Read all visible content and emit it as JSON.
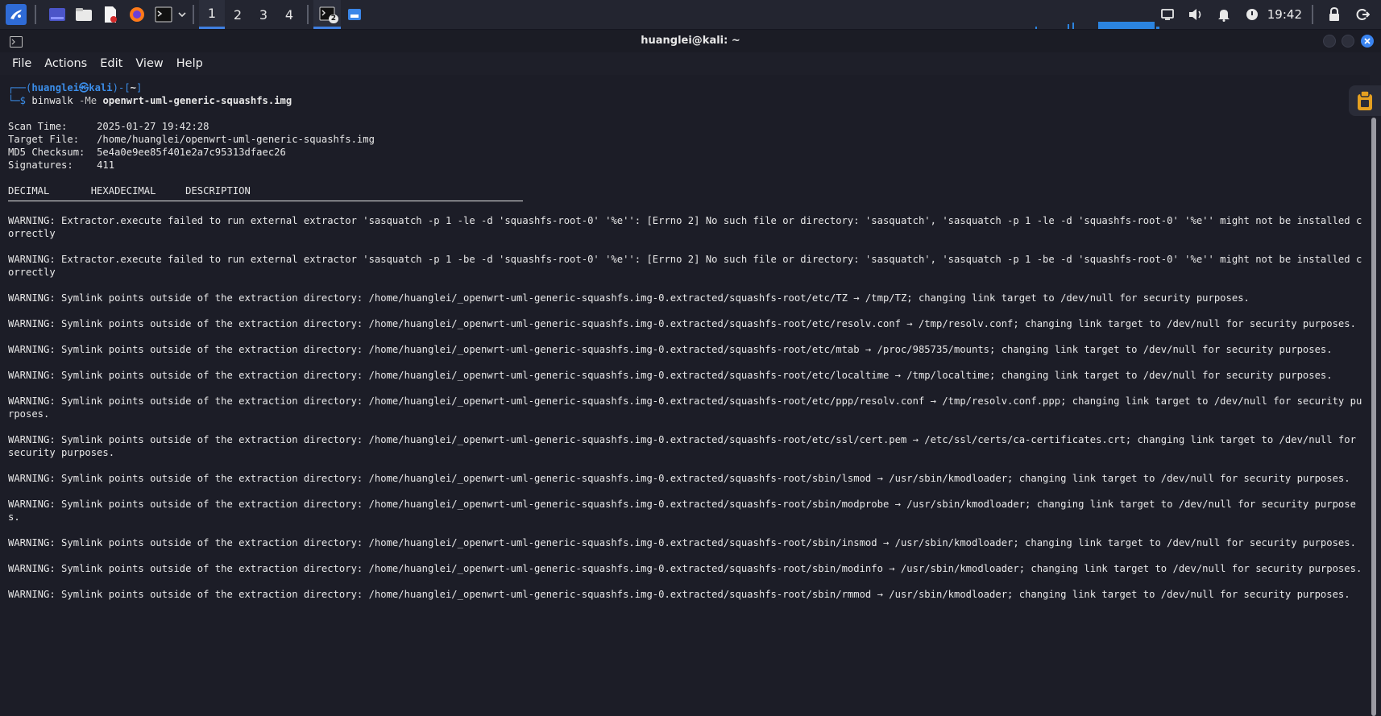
{
  "panel": {
    "workspaces": [
      "1",
      "2",
      "3",
      "4"
    ],
    "active_workspace": 0,
    "terminal_badge": "2",
    "clock": "19:42"
  },
  "window": {
    "title": "huanglei@kali: ~",
    "menu": [
      "File",
      "Actions",
      "Edit",
      "View",
      "Help"
    ]
  },
  "terminal": {
    "prompt_open": "┌──(",
    "prompt_user": "huanglei㉿kali",
    "prompt_mid": ")-[",
    "prompt_dir": "~",
    "prompt_close": "]",
    "prompt_dollar": "└─$",
    "cmd_name": "binwalk",
    "cmd_flags": "-Me",
    "cmd_arg": "openwrt-uml-generic-squashfs.img",
    "info": [
      {
        "label": "Scan Time:     ",
        "value": "2025-01-27 19:42:28"
      },
      {
        "label": "Target File:   ",
        "value": "/home/huanglei/openwrt-uml-generic-squashfs.img"
      },
      {
        "label": "MD5 Checksum:  ",
        "value": "5e4a0e9ee85f401e2a7c95313dfaec26"
      },
      {
        "label": "Signatures:    ",
        "value": "411"
      }
    ],
    "header": "DECIMAL       HEXADECIMAL     DESCRIPTION",
    "warnings": [
      "WARNING: Extractor.execute failed to run external extractor 'sasquatch -p 1 -le -d 'squashfs-root-0' '%e'': [Errno 2] No such file or directory: 'sasquatch', 'sasquatch -p 1 -le -d 'squashfs-root-0' '%e'' might not be installed correctly",
      "WARNING: Extractor.execute failed to run external extractor 'sasquatch -p 1 -be -d 'squashfs-root-0' '%e'': [Errno 2] No such file or directory: 'sasquatch', 'sasquatch -p 1 -be -d 'squashfs-root-0' '%e'' might not be installed correctly",
      "WARNING: Symlink points outside of the extraction directory: /home/huanglei/_openwrt-uml-generic-squashfs.img-0.extracted/squashfs-root/etc/TZ → /tmp/TZ; changing link target to /dev/null for security purposes.",
      "WARNING: Symlink points outside of the extraction directory: /home/huanglei/_openwrt-uml-generic-squashfs.img-0.extracted/squashfs-root/etc/resolv.conf → /tmp/resolv.conf; changing link target to /dev/null for security purposes.",
      "WARNING: Symlink points outside of the extraction directory: /home/huanglei/_openwrt-uml-generic-squashfs.img-0.extracted/squashfs-root/etc/mtab → /proc/985735/mounts; changing link target to /dev/null for security purposes.",
      "WARNING: Symlink points outside of the extraction directory: /home/huanglei/_openwrt-uml-generic-squashfs.img-0.extracted/squashfs-root/etc/localtime → /tmp/localtime; changing link target to /dev/null for security purposes.",
      "WARNING: Symlink points outside of the extraction directory: /home/huanglei/_openwrt-uml-generic-squashfs.img-0.extracted/squashfs-root/etc/ppp/resolv.conf → /tmp/resolv.conf.ppp; changing link target to /dev/null for security purposes.",
      "WARNING: Symlink points outside of the extraction directory: /home/huanglei/_openwrt-uml-generic-squashfs.img-0.extracted/squashfs-root/etc/ssl/cert.pem → /etc/ssl/certs/ca-certificates.crt; changing link target to /dev/null for security purposes.",
      "WARNING: Symlink points outside of the extraction directory: /home/huanglei/_openwrt-uml-generic-squashfs.img-0.extracted/squashfs-root/sbin/lsmod → /usr/sbin/kmodloader; changing link target to /dev/null for security purposes.",
      "WARNING: Symlink points outside of the extraction directory: /home/huanglei/_openwrt-uml-generic-squashfs.img-0.extracted/squashfs-root/sbin/modprobe → /usr/sbin/kmodloader; changing link target to /dev/null for security purposes.",
      "WARNING: Symlink points outside of the extraction directory: /home/huanglei/_openwrt-uml-generic-squashfs.img-0.extracted/squashfs-root/sbin/insmod → /usr/sbin/kmodloader; changing link target to /dev/null for security purposes.",
      "WARNING: Symlink points outside of the extraction directory: /home/huanglei/_openwrt-uml-generic-squashfs.img-0.extracted/squashfs-root/sbin/modinfo → /usr/sbin/kmodloader; changing link target to /dev/null for security purposes.",
      "WARNING: Symlink points outside of the extraction directory: /home/huanglei/_openwrt-uml-generic-squashfs.img-0.extracted/squashfs-root/sbin/rmmod → /usr/sbin/kmodloader; changing link target to /dev/null for security purposes."
    ]
  },
  "colors": {
    "accent": "#3f7fe0",
    "prompt": "#3b8eea",
    "terminal_bg": "#1c1d27"
  },
  "icons": [
    "kali-menu-icon",
    "workspace-switcher-icon",
    "file-manager-icon",
    "text-editor-icon",
    "firefox-icon",
    "terminal-icon",
    "chevron-down-icon",
    "screen-icon",
    "volume-icon",
    "bell-icon",
    "power-icon",
    "lock-icon",
    "logout-icon",
    "clipboard-icon"
  ]
}
